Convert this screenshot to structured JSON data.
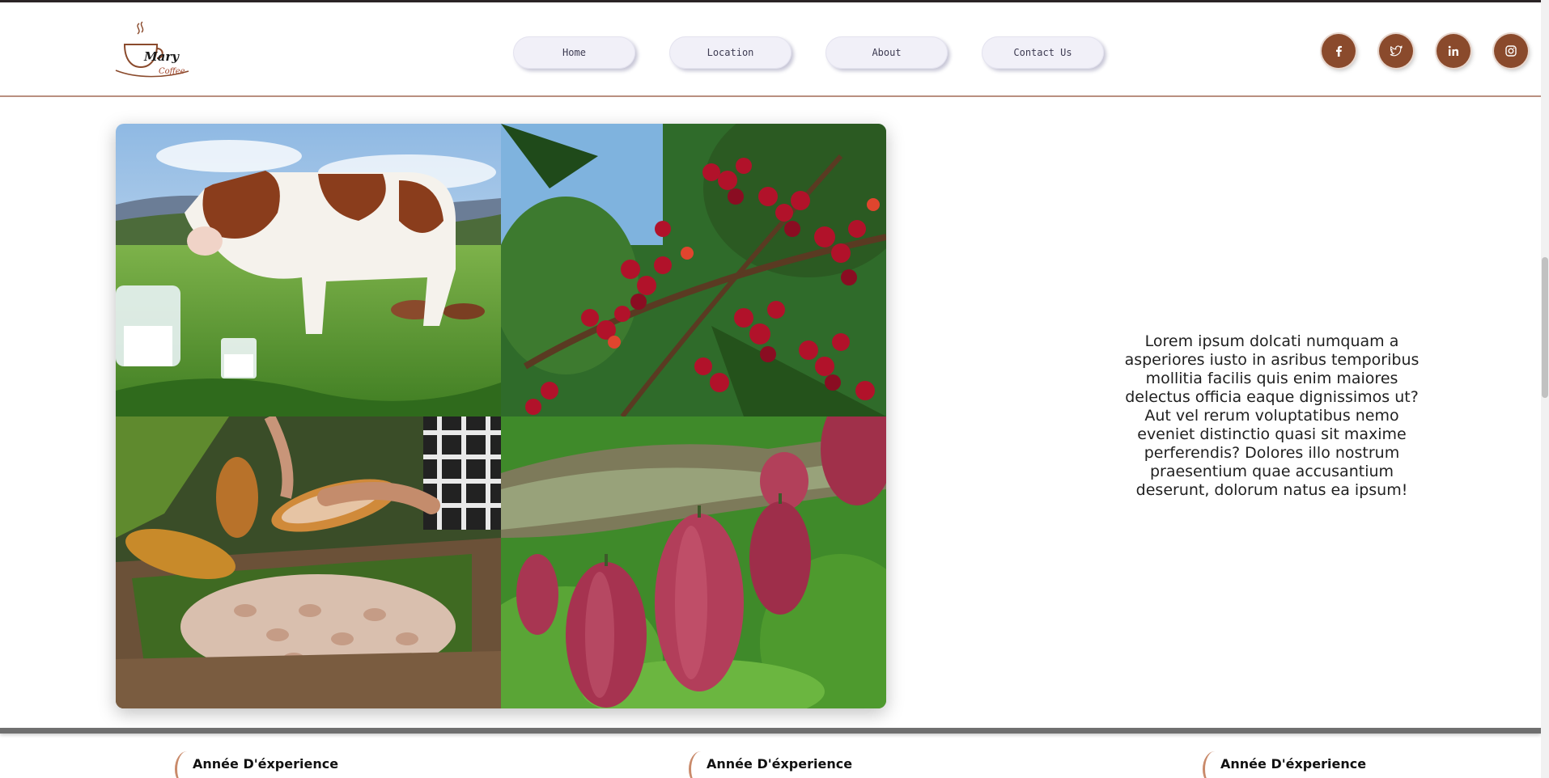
{
  "brand": {
    "line1": "Mary",
    "line2": "Coffee",
    "colors": {
      "primary": "#8a4a2c",
      "accent": "#c98a6a"
    }
  },
  "nav": [
    {
      "label": "Home"
    },
    {
      "label": "Location"
    },
    {
      "label": "About"
    },
    {
      "label": "Contact Us"
    }
  ],
  "socials": [
    {
      "icon": "facebook-icon"
    },
    {
      "icon": "twitter-icon"
    },
    {
      "icon": "linkedin-icon"
    },
    {
      "icon": "instagram-icon"
    }
  ],
  "gallery": [
    {
      "subject": "cow-milk"
    },
    {
      "subject": "coffee-cherries"
    },
    {
      "subject": "cocoa-beans"
    },
    {
      "subject": "cocoa-pods"
    }
  ],
  "intro": {
    "text": "Lorem ipsum dolcati numquam a asperiores iusto in asribus temporibus mollitia facilis quis enim maiores delectus officia eaque dignissimos ut? Aut vel rerum voluptatibus nemo eveniet distinctio quasi sit maxime perferendis? Dolores illo nostrum praesentium quae accusantium deserunt, dolorum natus ea ipsum!"
  },
  "stats": [
    {
      "label": "Année D'éxperience"
    },
    {
      "label": "Année D'éxperience"
    },
    {
      "label": "Année D'éxperience"
    }
  ]
}
